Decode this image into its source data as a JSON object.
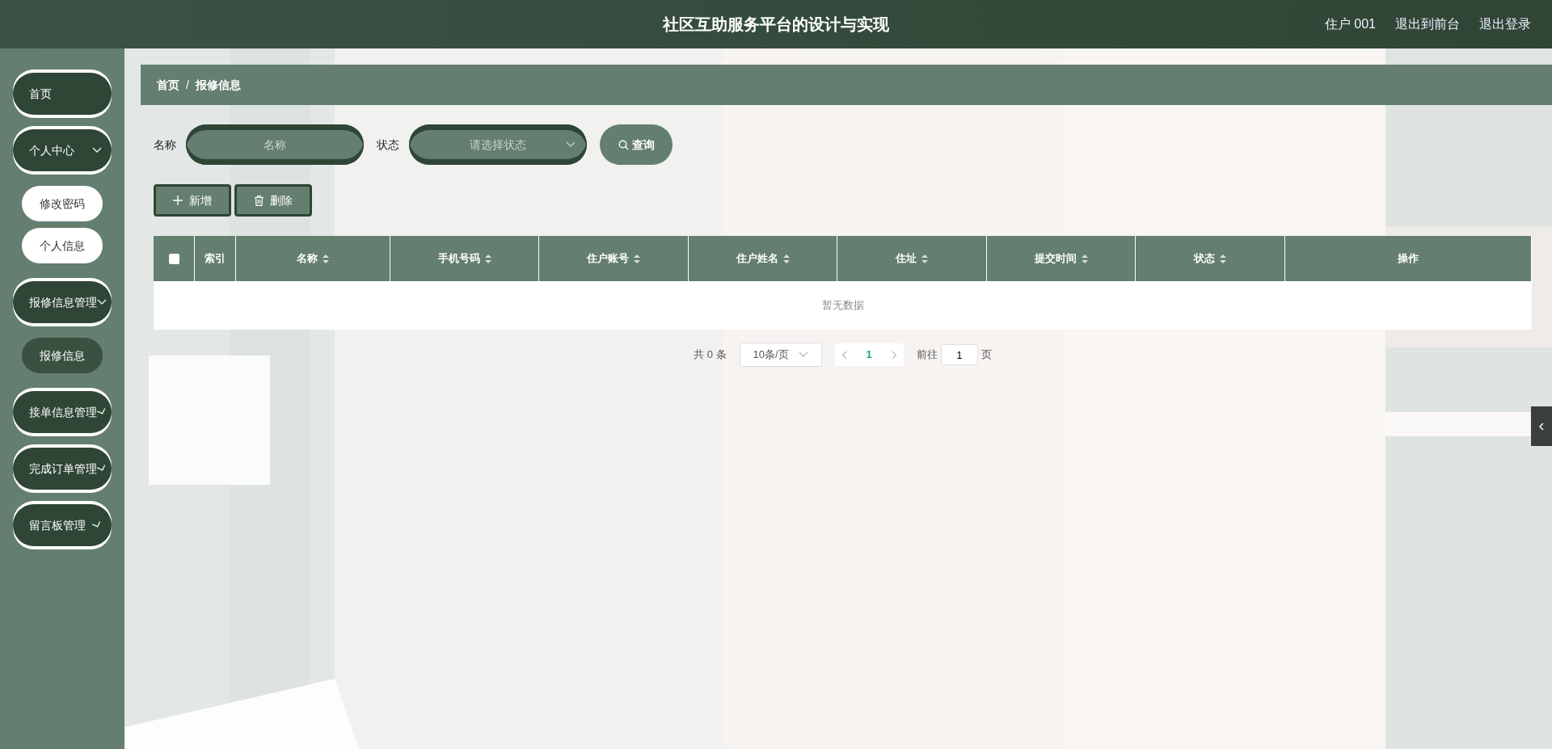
{
  "header": {
    "title": "社区互助服务平台的设计与实现",
    "links": [
      "住户 001",
      "退出到前台",
      "退出登录"
    ]
  },
  "sidebar": {
    "items": [
      {
        "label": "首页"
      },
      {
        "label": "个人中心",
        "expanded": true,
        "children": [
          {
            "label": "修改密码",
            "selected": false
          },
          {
            "label": "个人信息",
            "selected": false
          }
        ]
      },
      {
        "label": "报修信息管理",
        "expanded": true,
        "children": [
          {
            "label": "报修信息",
            "selected": true
          }
        ]
      },
      {
        "label": "接单信息管理",
        "expanded": false
      },
      {
        "label": "完成订单管理",
        "expanded": false
      },
      {
        "label": "留言板管理",
        "expanded": false
      }
    ]
  },
  "breadcrumb": {
    "items": [
      "首页",
      "报修信息"
    ],
    "separator": "/"
  },
  "search": {
    "name_label": "名称",
    "name_placeholder": "名称",
    "status_label": "状态",
    "status_placeholder": "请选择状态",
    "button": "查询"
  },
  "actions": [
    {
      "kind": "add",
      "label": "新增"
    },
    {
      "kind": "delete",
      "label": "删除"
    }
  ],
  "table": {
    "columns": [
      {
        "kind": "checkbox",
        "checked": false
      },
      {
        "label": "索引",
        "sortable": false
      },
      {
        "label": "名称",
        "sortable": true
      },
      {
        "label": "手机号码",
        "sortable": true
      },
      {
        "label": "住户账号",
        "sortable": true
      },
      {
        "label": "住户姓名",
        "sortable": true
      },
      {
        "label": "住址",
        "sortable": true
      },
      {
        "label": "提交时间",
        "sortable": true
      },
      {
        "label": "状态",
        "sortable": true
      },
      {
        "label": "操作",
        "sortable": false
      }
    ],
    "empty_text": "暂无数据"
  },
  "pagination": {
    "total": "共 0 条",
    "page_size": "10条/页",
    "pages": [
      {
        "label": "1",
        "selected": true
      }
    ],
    "goto_label": "前往",
    "goto_value": "1",
    "page_suffix": "页"
  }
}
